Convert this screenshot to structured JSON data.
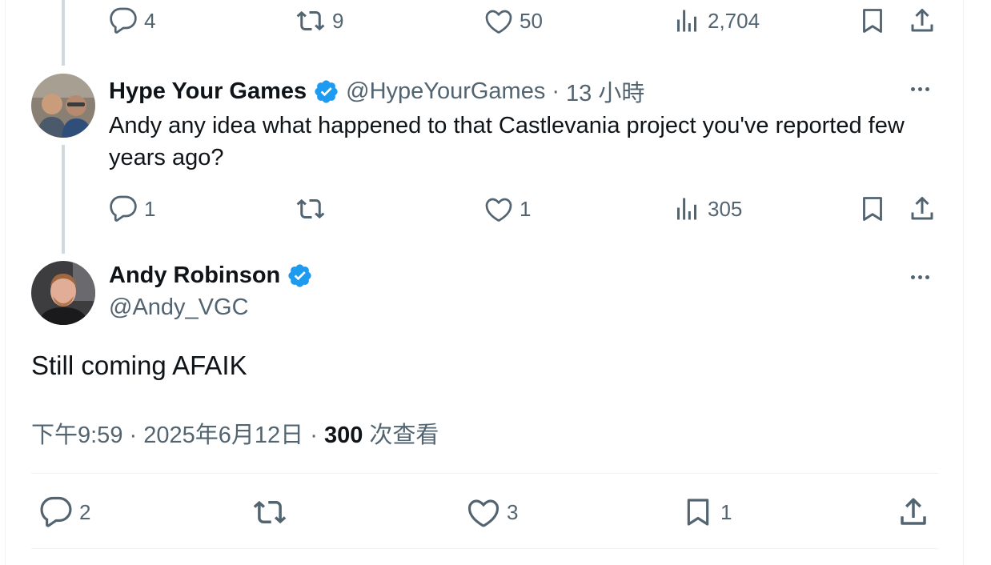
{
  "colors": {
    "text": "#0f1419",
    "secondary": "#536471",
    "verified": "#1d9bf0",
    "border": "#eff3f4",
    "thread_line": "#cfd9de"
  },
  "prev_tweet": {
    "actions": {
      "replies": "4",
      "reposts": "9",
      "likes": "50",
      "views": "2,704"
    }
  },
  "reply_tweet": {
    "name": "Hype Your Games",
    "handle": "@HypeYourGames",
    "separator": "·",
    "time": "13 小時",
    "text": "Andy any idea what happened to that Castlevania project you've reported few years ago?",
    "actions": {
      "replies": "1",
      "reposts": "",
      "likes": "1",
      "views": "305"
    }
  },
  "main_tweet": {
    "name": "Andy Robinson",
    "handle": "@Andy_VGC",
    "text": "Still coming AFAIK",
    "time": "下午9:59",
    "sep1": "·",
    "date": "2025年6月12日",
    "sep2": "·",
    "views_count": "300",
    "views_label": "次查看",
    "actions": {
      "replies": "2",
      "likes": "3",
      "bookmarks": "1"
    }
  },
  "icons": [
    "reply-icon",
    "repost-icon",
    "like-icon",
    "views-icon",
    "bookmark-icon",
    "share-icon",
    "verified-icon",
    "more-icon"
  ]
}
